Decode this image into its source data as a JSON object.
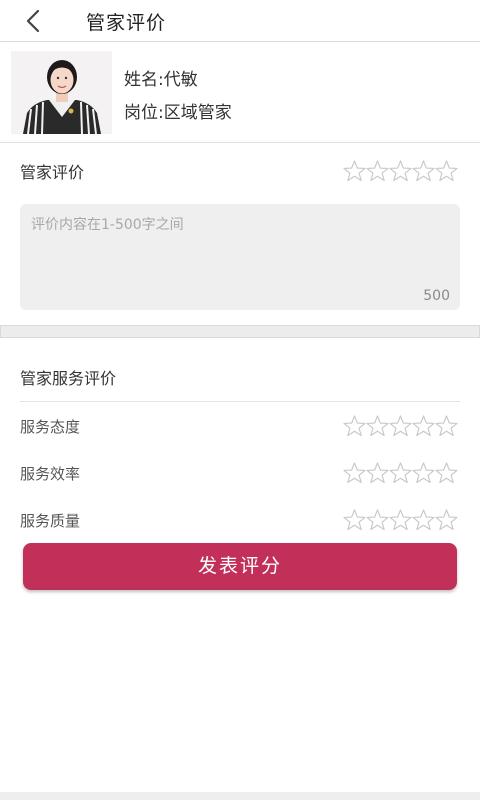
{
  "header": {
    "title": "管家评价",
    "back_icon": "chevron-left-icon"
  },
  "profile": {
    "name_label": "姓名:代敏",
    "position_label": "岗位:区域管家"
  },
  "review": {
    "title": "管家评价",
    "placeholder": "评价内容在1-500字之间",
    "char_limit": "500",
    "rating": 0,
    "max_rating": 5
  },
  "service": {
    "title": "管家服务评价",
    "items": [
      {
        "label": "服务态度",
        "rating": 0
      },
      {
        "label": "服务效率",
        "rating": 0
      },
      {
        "label": "服务质量",
        "rating": 0
      }
    ]
  },
  "submit_label": "发表评分",
  "colors": {
    "accent": "#c2305a",
    "star_outline": "#c8c8c8",
    "input_bg": "#efefef"
  }
}
